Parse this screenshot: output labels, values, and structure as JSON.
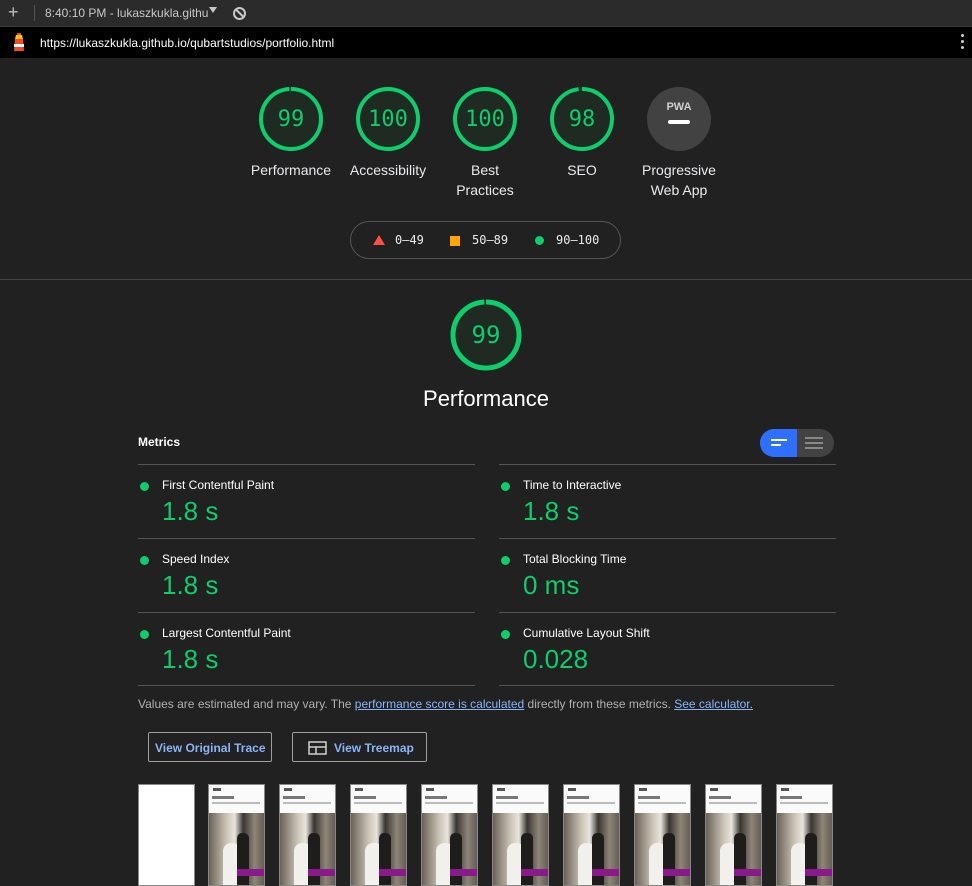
{
  "tab": {
    "title": "8:40:10 PM - lukaszkukla.githu",
    "new_tab_icon": "plus-icon",
    "block_icon": "block-icon"
  },
  "url": {
    "text": "https://lukaszkukla.github.io/qubartstudios/portfolio.html"
  },
  "colors": {
    "pass": "#0cce6b",
    "average": "#ffa400",
    "fail": "#ff4e42",
    "accent": "#2f6fff",
    "link": "#8ab4f8"
  },
  "gauges": [
    {
      "score": "99",
      "label": "Performance",
      "fraction": 0.99
    },
    {
      "score": "100",
      "label": "Accessibility",
      "fraction": 1.0
    },
    {
      "score": "100",
      "label": "Best",
      "label2": "Practices",
      "fraction": 1.0
    },
    {
      "score": "98",
      "label": "SEO",
      "fraction": 0.98
    },
    {
      "score": "PWA",
      "label": "Progressive",
      "label2": "Web App"
    }
  ],
  "legend": {
    "fail": "0–49",
    "average": "50–89",
    "pass": "90–100"
  },
  "performance": {
    "score": "99",
    "fraction": 0.99,
    "title": "Performance"
  },
  "metrics": {
    "heading": "Metrics",
    "items": [
      {
        "name": "First Contentful Paint",
        "value": "1.8 s"
      },
      {
        "name": "Time to Interactive",
        "value": "1.8 s"
      },
      {
        "name": "Speed Index",
        "value": "1.8 s"
      },
      {
        "name": "Total Blocking Time",
        "value": "0 ms"
      },
      {
        "name": "Largest Contentful Paint",
        "value": "1.8 s"
      },
      {
        "name": "Cumulative Layout Shift",
        "value": "0.028"
      }
    ]
  },
  "note": {
    "prefix": "Values are estimated and may vary. The ",
    "link1": "performance score is calculated",
    "middle": " directly from these metrics. ",
    "link2": "See calculator."
  },
  "buttons": {
    "trace": "View Original Trace",
    "treemap": "View Treemap"
  },
  "filmstrip": {
    "thumb_text": "portfolio"
  }
}
